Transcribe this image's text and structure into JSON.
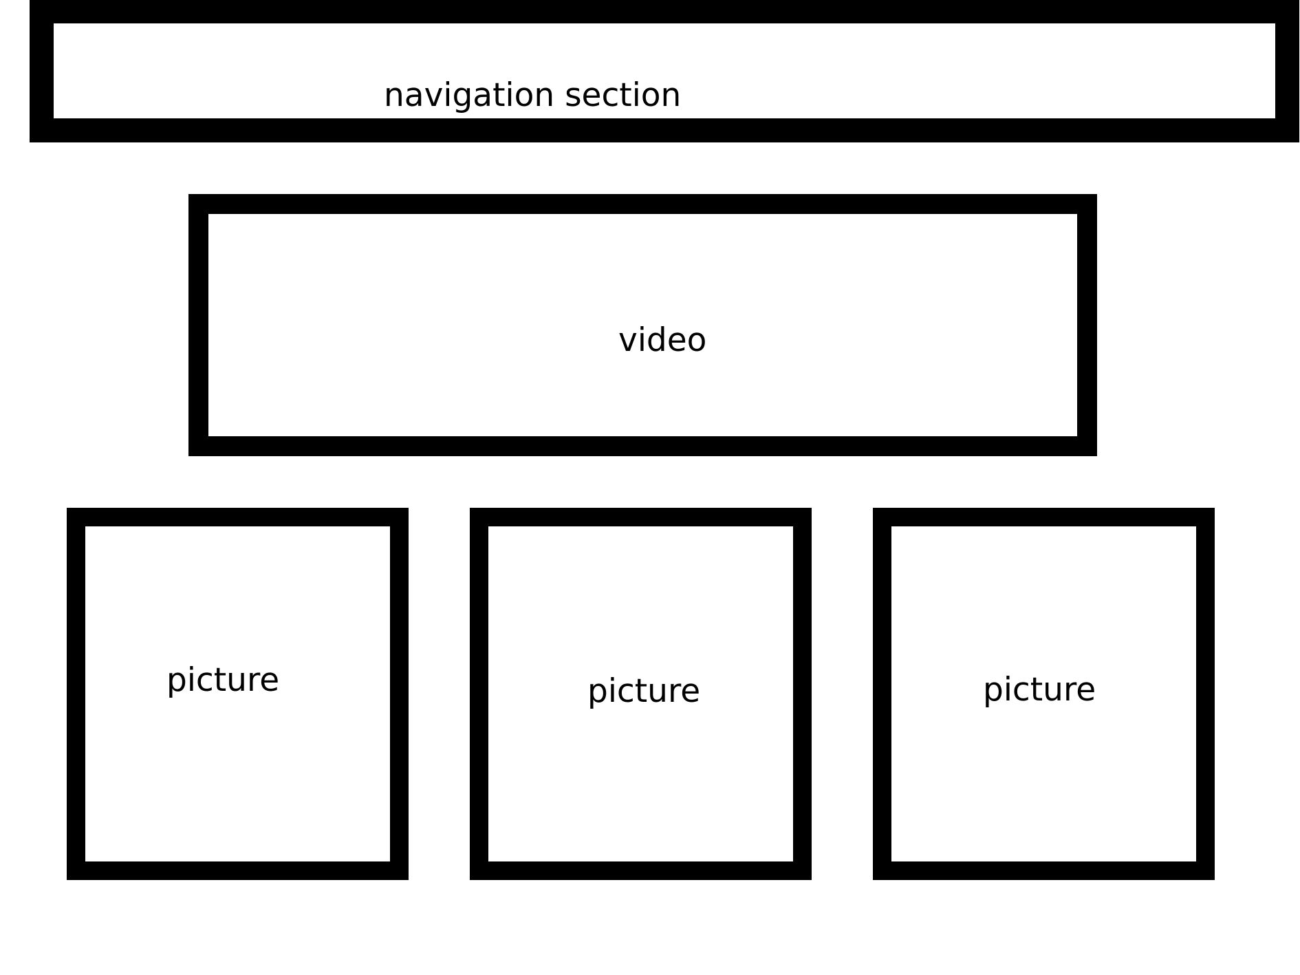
{
  "navigation": {
    "label": "navigation section"
  },
  "video": {
    "label": "video"
  },
  "pictures": [
    {
      "label": "picture"
    },
    {
      "label": "picture"
    },
    {
      "label": "picture"
    }
  ],
  "colors": {
    "stroke": "#000000",
    "background": "#ffffff"
  }
}
